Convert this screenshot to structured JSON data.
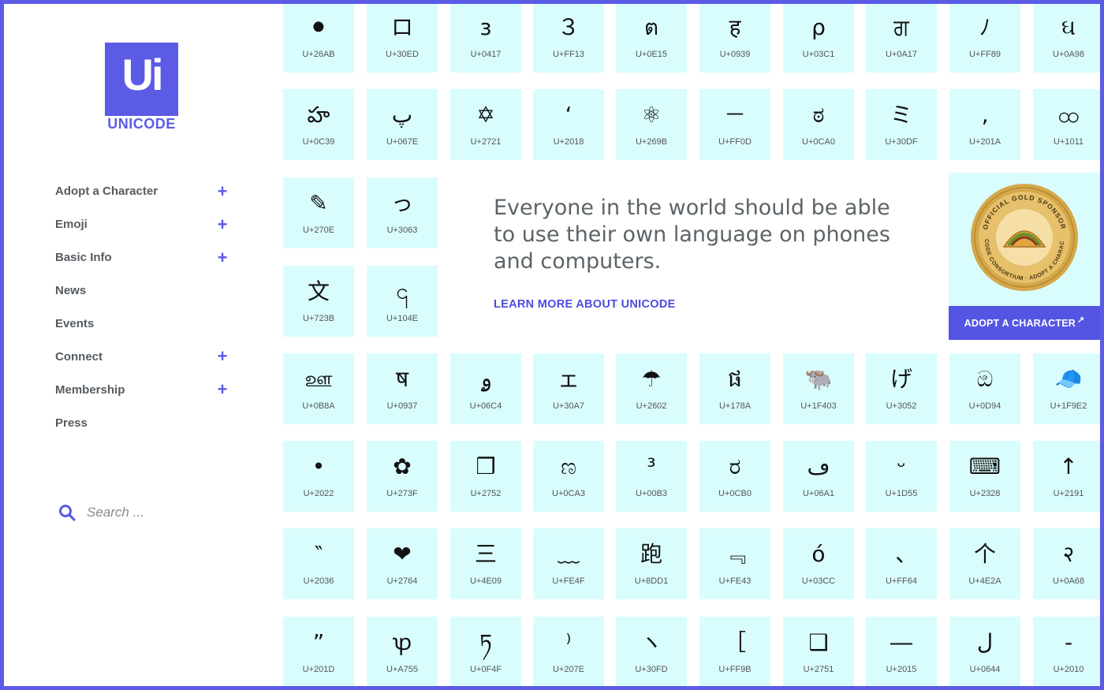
{
  "logo": {
    "mark": "Ui",
    "word": "UNICODE"
  },
  "nav": [
    {
      "label": "Adopt a Character",
      "expand": "+"
    },
    {
      "label": "Emoji",
      "expand": "+"
    },
    {
      "label": "Basic Info",
      "expand": "+"
    },
    {
      "label": "News",
      "expand": ""
    },
    {
      "label": "Events",
      "expand": ""
    },
    {
      "label": "Connect",
      "expand": "+"
    },
    {
      "label": "Membership",
      "expand": "+"
    },
    {
      "label": "Press",
      "expand": ""
    }
  ],
  "search": {
    "placeholder": "Search ..."
  },
  "hero": {
    "text": "Everyone in the world should be able to use their own language on phones and computers.",
    "link": "LEARN MORE ABOUT UNICODE"
  },
  "sponsor": {
    "badge_top": "OFFICIAL GOLD SPONSOR",
    "badge_bottom": "UNICODE CONSORTIUM · ADOPT A CHARACTER",
    "button": "ADOPT A CHARACTER",
    "button_icon": "external-link-icon"
  },
  "colors": {
    "accent": "#5b5be6",
    "tile": "#d9fdfd",
    "gold": "#d4a84a"
  },
  "tiles": {
    "r0": [
      {
        "ch": "⚫",
        "cp": "U+26AB"
      },
      {
        "ch": "ロ",
        "cp": "U+30ED"
      },
      {
        "ch": "з",
        "cp": "U+0417"
      },
      {
        "ch": "３",
        "cp": "U+FF13"
      },
      {
        "ch": "ต",
        "cp": "U+0E15"
      },
      {
        "ch": "ह",
        "cp": "U+0939"
      },
      {
        "ch": "ρ",
        "cp": "U+03C1"
      },
      {
        "ch": "ਗ",
        "cp": "U+0A17"
      },
      {
        "ch": "ﾉ",
        "cp": "U+FF89"
      },
      {
        "ch": "ઘ",
        "cp": "U+0A98"
      }
    ],
    "r1": [
      {
        "ch": "హ",
        "cp": "U+0C39"
      },
      {
        "ch": "پ",
        "cp": "U+067E"
      },
      {
        "ch": "✡",
        "cp": "U+2721"
      },
      {
        "ch": "‘",
        "cp": "U+2018"
      },
      {
        "ch": "⚛",
        "cp": "U+269B"
      },
      {
        "ch": "－",
        "cp": "U+FF0D"
      },
      {
        "ch": "ಠ",
        "cp": "U+0CA0"
      },
      {
        "ch": "ミ",
        "cp": "U+30DF"
      },
      {
        "ch": "‚",
        "cp": "U+201A"
      },
      {
        "ch": "ထ",
        "cp": "U+1011"
      }
    ],
    "r2": [
      {
        "ch": "✎",
        "cp": "U+270E"
      },
      {
        "ch": "っ",
        "cp": "U+3063"
      }
    ],
    "r3": [
      {
        "ch": "文",
        "cp": "U+723B"
      },
      {
        "ch": "၎",
        "cp": "U+104E"
      }
    ],
    "r4": [
      {
        "ch": "ஊ",
        "cp": "U+0B8A"
      },
      {
        "ch": "ष",
        "cp": "U+0937"
      },
      {
        "ch": "ۄ",
        "cp": "U+06C4"
      },
      {
        "ch": "ェ",
        "cp": "U+30A7"
      },
      {
        "ch": "☂",
        "cp": "U+2602"
      },
      {
        "ch": "ផ",
        "cp": "U+178A"
      },
      {
        "ch": "🐃",
        "cp": "U+1F403"
      },
      {
        "ch": "げ",
        "cp": "U+3052"
      },
      {
        "ch": "ඔ",
        "cp": "U+0D94"
      },
      {
        "ch": "🧢",
        "cp": "U+1F9E2"
      }
    ],
    "r5": [
      {
        "ch": "•",
        "cp": "U+2022"
      },
      {
        "ch": "✿",
        "cp": "U+273F"
      },
      {
        "ch": "❒",
        "cp": "U+2752"
      },
      {
        "ch": "ಣ",
        "cp": "U+0CA3"
      },
      {
        "ch": "³",
        "cp": "U+00B3"
      },
      {
        "ch": "ರ",
        "cp": "U+0CB0"
      },
      {
        "ch": "ڡ",
        "cp": "U+06A1"
      },
      {
        "ch": "ᵕ",
        "cp": "U+1D55"
      },
      {
        "ch": "⌨",
        "cp": "U+2328"
      },
      {
        "ch": "↑",
        "cp": "U+2191"
      }
    ],
    "r6": [
      {
        "ch": "‶",
        "cp": "U+2036"
      },
      {
        "ch": "❤",
        "cp": "U+2764"
      },
      {
        "ch": "三",
        "cp": "U+4E09"
      },
      {
        "ch": "﹏",
        "cp": "U+FE4F"
      },
      {
        "ch": "跑",
        "cp": "U+8DD1"
      },
      {
        "ch": "﹃",
        "cp": "U+FE43"
      },
      {
        "ch": "ό",
        "cp": "U+03CC"
      },
      {
        "ch": "､",
        "cp": "U+FF64"
      },
      {
        "ch": "个",
        "cp": "U+4E2A"
      },
      {
        "ch": "२",
        "cp": "U+0A68"
      }
    ],
    "r7": [
      {
        "ch": "”",
        "cp": "U+201D"
      },
      {
        "ch": "ꝕ",
        "cp": "U+A755"
      },
      {
        "ch": "ཏ",
        "cp": "U+0F4F"
      },
      {
        "ch": "⁾",
        "cp": "U+207E"
      },
      {
        "ch": "ヽ",
        "cp": "U+30FD"
      },
      {
        "ch": "［",
        "cp": "U+FF9B"
      },
      {
        "ch": "❑",
        "cp": "U+2751"
      },
      {
        "ch": "―",
        "cp": "U+2015"
      },
      {
        "ch": "ل",
        "cp": "U+0644"
      },
      {
        "ch": "‐",
        "cp": "U+2010"
      }
    ]
  }
}
